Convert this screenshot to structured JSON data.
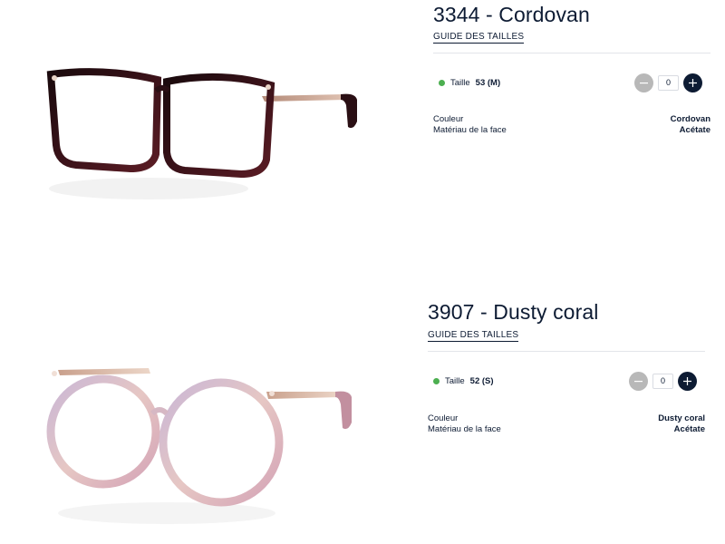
{
  "products": [
    {
      "title": "3344 - Cordovan",
      "guide_label": "GUIDE DES TAILLES",
      "size_label": "Taille",
      "size_value": "53 (M)",
      "quantity": "0",
      "attributes": [
        {
          "label": "Couleur",
          "value": "Cordovan"
        },
        {
          "label": "Matériau de la face",
          "value": "Acétate"
        }
      ],
      "image": {
        "name": "glasses-cordovan-image",
        "frame_color": "#2a0f14",
        "temple_color": "#c7a391"
      }
    },
    {
      "title": "3907 - Dusty coral",
      "guide_label": "GUIDE DES TAILLES",
      "size_label": "Taille",
      "size_value": "52 (S)",
      "quantity": "0",
      "attributes": [
        {
          "label": "Couleur",
          "value": "Dusty coral"
        },
        {
          "label": "Matériau de la face",
          "value": "Acétate"
        }
      ],
      "image": {
        "name": "glasses-dusty-coral-image",
        "frame_color": "#c9a6b8",
        "temple_color": "#d8b7a0"
      }
    }
  ],
  "colors": {
    "text_primary": "#0d1b33",
    "available_dot": "#4caf50",
    "minus_button": "#b8b8b8",
    "plus_button": "#0d1b33"
  },
  "icons": {
    "available": "status-dot-icon",
    "minus": "minus-icon",
    "plus": "plus-icon"
  }
}
